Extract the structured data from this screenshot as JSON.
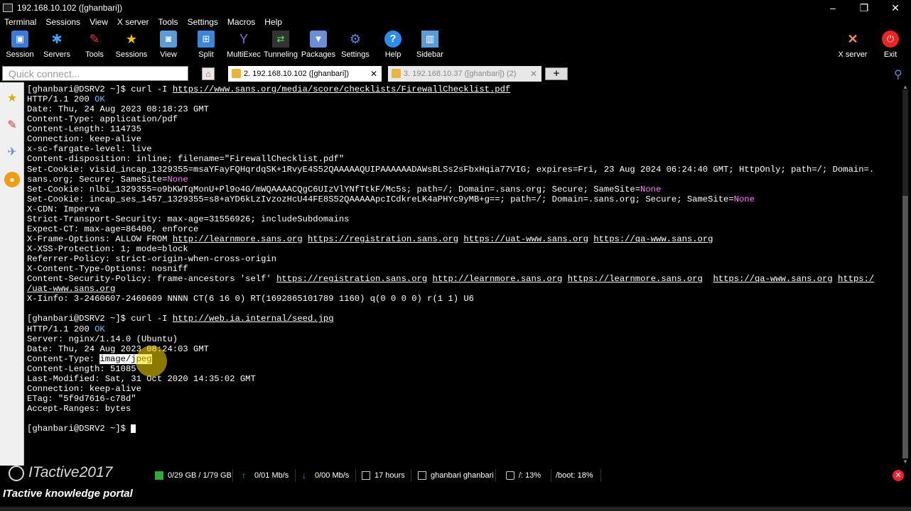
{
  "window": {
    "title": "192.168.10.102 ([ghanbari])",
    "minimize": "–",
    "maximize": "❐",
    "close": "✕"
  },
  "menu": [
    "Terminal",
    "Sessions",
    "View",
    "X server",
    "Tools",
    "Settings",
    "Macros",
    "Help"
  ],
  "toolbar": {
    "left": [
      {
        "label": "Session",
        "icon": "session-icon"
      },
      {
        "label": "Servers",
        "icon": "servers-icon"
      },
      {
        "label": "Tools",
        "icon": "tools-icon"
      },
      {
        "label": "Sessions",
        "icon": "star-icon"
      },
      {
        "label": "View",
        "icon": "view-icon"
      },
      {
        "label": "Split",
        "icon": "split-icon"
      },
      {
        "label": "MultiExec",
        "icon": "multiexec-icon"
      },
      {
        "label": "Tunneling",
        "icon": "tunneling-icon"
      },
      {
        "label": "Packages",
        "icon": "packages-icon"
      },
      {
        "label": "Settings",
        "icon": "gear-icon"
      },
      {
        "label": "Help",
        "icon": "help-icon"
      },
      {
        "label": "Sidebar",
        "icon": "sidebar-icon"
      }
    ],
    "right": [
      {
        "label": "X server",
        "icon": "x-server-icon"
      },
      {
        "label": "Exit",
        "icon": "power-icon"
      }
    ]
  },
  "tabs": {
    "quick_connect_placeholder": "Quick connect...",
    "active": "2. 192.168.10.102 ([ghanbari])",
    "inactive": "3. 192.168.10.37 ([ghanbari]) (2)",
    "close": "✕",
    "add": "+"
  },
  "terminal": {
    "prompt": "[ghanbari@DSRV2 ~]$",
    "cmd1": "curl -I",
    "url1": "https://www.sans.org/media/score/checklists/FirewallChecklist.pdf",
    "http1_status": "HTTP/1.1 200",
    "ok": "OK",
    "date1": "Date: Thu, 24 Aug 2023 08:18:23 GMT",
    "content_type1": "Content-Type: application/pdf",
    "content_length1": "Content-Length: 114735",
    "connection1": "Connection: keep-alive",
    "fargate": "x-sc-fargate-level: live",
    "content_disposition": "Content-disposition: inline; filename=\"FirewallChecklist.pdf\"",
    "cookie1_a": "Set-Cookie: visid_incap_1329355=msaYFayFQHqrdqSK+1RvyE4S52QAAAAAQUIPAAAAAADAWsBLSs2sFbxHqia77VIG; expires=Fri, 23 Aug 2024 06:24:40 GMT; HttpOnly; path=/; Domain=.",
    "cookie1_b": "sans.org; Secure; SameSite=",
    "none": "None",
    "cookie2": "Set-Cookie: nlbi_1329355=o9bKWTqMonU+Pl9o4G/mWQAAAACQgC6UIzVlYNfTtkF/Mc5s; path=/; Domain=.sans.org; Secure; SameSite=",
    "cookie3": "Set-Cookie: incap_ses_1457_1329355=s8+aYD6kLzIvzozHcU44FE8S52QAAAAApcICdkreLK4aPHYc9yMB+g==; path=/; Domain=.sans.org; Secure; SameSite=",
    "xcdn": "X-CDN: Imperva",
    "sts": "Strict-Transport-Security: max-age=31556926; includeSubdomains",
    "expect_ct": "Expect-CT: max-age=86400, enforce",
    "xfo_label": "X-Frame-Options: ALLOW FROM",
    "xfo_url1": "http://learnmore.sans.org",
    "xfo_url2": "https://registration.sans.org",
    "xfo_url3": "https://uat-www.sans.org",
    "xfo_url4": "https://qa-www.sans.org",
    "xss": "X-XSS-Protection: 1; mode=block",
    "referrer": "Referrer-Policy: strict-origin-when-cross-origin",
    "xcto": "X-Content-Type-Options: nosniff",
    "csp_label": "Content-Security-Policy: frame-ancestors 'self'",
    "csp_url1": "https://registration.sans.org",
    "csp_url2": "http://learnmore.sans.org",
    "csp_url3": "https://learnmore.sans.org",
    "csp_url4": "https://qa-www.sans.org",
    "csp_url5a": "https:/",
    "csp_url5b": "/uat-www.sans.org",
    "xiinfo": "X-Iinfo: 3-2460607-2460609 NNNN CT(6 16 0) RT(1692865101789 1160) q(0 0 0 0) r(1 1) U6",
    "url2": "http://web.ia.internal/seed.jpg",
    "server2": "Server: nginx/1.14.0 (Ubuntu)",
    "date2": "Date: Thu, 24 Aug 2023 08:24:03 GMT",
    "content_type2_label": "Content-Type: ",
    "content_type2_value": "image/jpeg",
    "content_length2": "Content-Length: 51085",
    "last_modified": "Last-Modified: Sat, 31 Oct 2020 14:35:02 GMT",
    "connection2": "Connection: keep-alive",
    "etag": "ETag: \"5f9d7616-c78d\"",
    "accept_ranges": "Accept-Ranges: bytes"
  },
  "statusbar": {
    "disk": "0/29 GB / 1/79 GB",
    "upload": "0/01 Mb/s",
    "download": "0/00 Mb/s",
    "uptime": "17 hours",
    "user": "ghanbari  ghanbari",
    "root_usage": "/: 13%",
    "boot_usage": "/boot: 18%",
    "close": "✕"
  },
  "watermark": {
    "text": "ITactive2017",
    "footer": "ITactive knowledge portal"
  }
}
